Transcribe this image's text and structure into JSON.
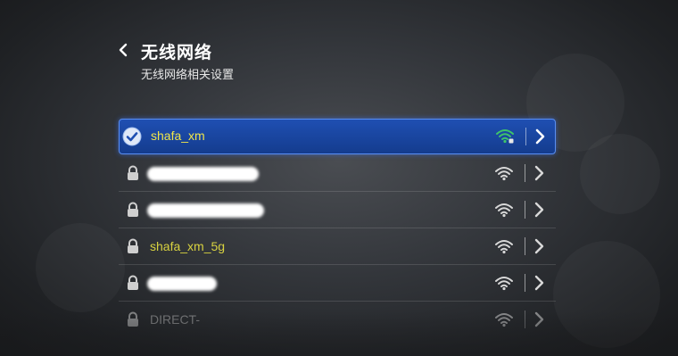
{
  "header": {
    "back_icon": "chevron-left-icon",
    "title": "无线网络",
    "subtitle": "无线网络相关设置"
  },
  "networks": [
    {
      "name": "shafa_xm",
      "status": "connected",
      "icon": "check-circle-icon",
      "signal": "wifi-icon"
    },
    {
      "name": "",
      "status": "locked",
      "icon": "lock-icon",
      "signal": "wifi-icon"
    },
    {
      "name": "",
      "status": "locked",
      "icon": "lock-icon",
      "signal": "wifi-icon"
    },
    {
      "name": "shafa_xm_5g",
      "status": "locked",
      "icon": "lock-icon",
      "signal": "wifi-icon"
    },
    {
      "name": "",
      "status": "locked",
      "icon": "lock-icon",
      "signal": "wifi-icon"
    },
    {
      "name": "DIRECT-",
      "status": "locked",
      "icon": "lock-icon",
      "signal": "wifi-icon"
    }
  ],
  "colors": {
    "selected_bg": "#1a48a6",
    "connected_wifi": "#3ec46a",
    "ssid_text": "#d8d240"
  }
}
